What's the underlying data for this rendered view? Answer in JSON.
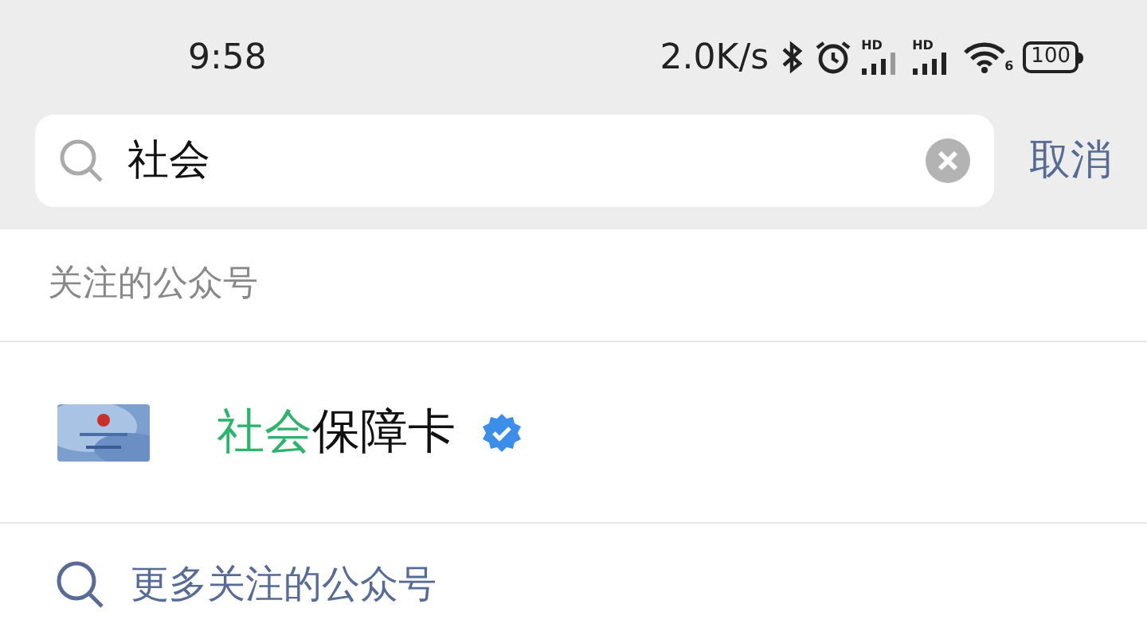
{
  "status_bar": {
    "time": "9:58",
    "speed": "2.0K/s",
    "signals": [
      {
        "label": "HD"
      },
      {
        "label": "HD"
      }
    ],
    "wifi_label": "6",
    "battery": "100"
  },
  "search": {
    "value": "社会",
    "cancel": "取消"
  },
  "section": {
    "title": "关注的公众号"
  },
  "results": [
    {
      "title_match": "社会",
      "title_rest": "保障卡",
      "verified": true,
      "kind": "picture"
    }
  ],
  "more": {
    "label": "更多关注的公众号"
  }
}
